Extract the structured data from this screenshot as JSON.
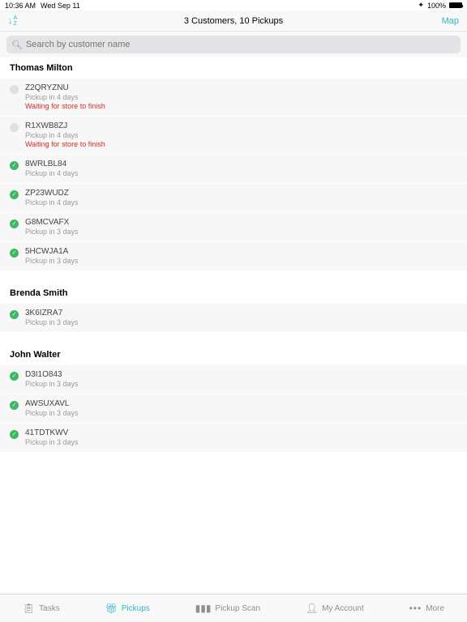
{
  "statusbar": {
    "time": "10:36 AM",
    "date": "Wed Sep 11",
    "battery_pct": "100%"
  },
  "header": {
    "title": "3 Customers, 10 Pickups",
    "map_label": "Map"
  },
  "search": {
    "placeholder": "Search by customer name"
  },
  "sections": [
    {
      "name": "Thomas Milton",
      "items": [
        {
          "code": "Z2QRYZNU",
          "sub": "Pickup in 4 days",
          "warn": "Waiting for store to finish",
          "status": "pending"
        },
        {
          "code": "R1XWB8ZJ",
          "sub": "Pickup in 4 days",
          "warn": "Waiting for store to finish",
          "status": "pending"
        },
        {
          "code": "8WRLBL84",
          "sub": "Pickup in 4 days",
          "status": "ready"
        },
        {
          "code": "ZP23WUDZ",
          "sub": "Pickup in 4 days",
          "status": "ready"
        },
        {
          "code": "G8MCVAFX",
          "sub": "Pickup in 3 days",
          "status": "ready"
        },
        {
          "code": "5HCWJA1A",
          "sub": "Pickup in 3 days",
          "status": "ready"
        }
      ]
    },
    {
      "name": "Brenda Smith",
      "items": [
        {
          "code": "3K6IZRA7",
          "sub": "Pickup in 3 days",
          "status": "ready"
        }
      ]
    },
    {
      "name": "John Walter",
      "items": [
        {
          "code": "D3I1O843",
          "sub": "Pickup in 3 days",
          "status": "ready"
        },
        {
          "code": "AWSUXAVL",
          "sub": "Pickup in 3 days",
          "status": "ready"
        },
        {
          "code": "41TDTKWV",
          "sub": "Pickup in 3 days",
          "status": "ready"
        }
      ]
    }
  ],
  "tabs": {
    "tasks": "Tasks",
    "pickups": "Pickups",
    "pickup_scan": "Pickup Scan",
    "my_account": "My Account",
    "more": "More"
  }
}
